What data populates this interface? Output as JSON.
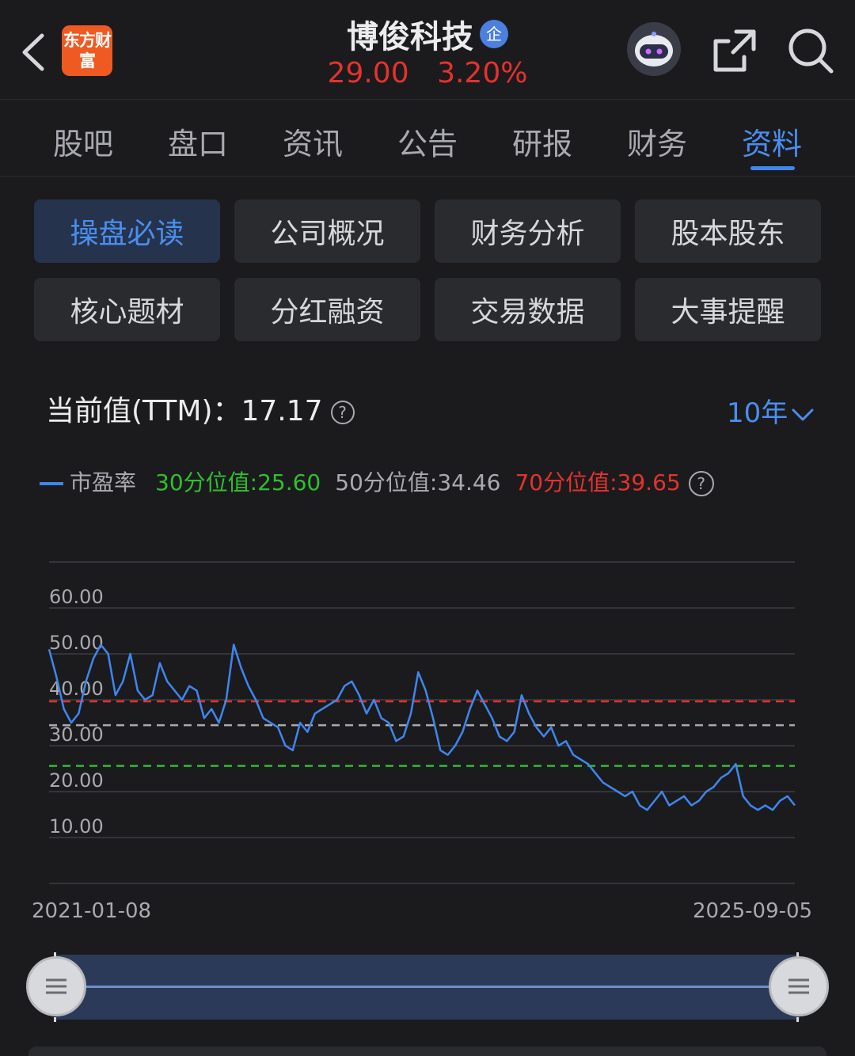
{
  "header": {
    "logo_text": "东方财富",
    "stock_name": "博俊科技",
    "badge": "企",
    "price": "29.00",
    "change_pct": "3.20%"
  },
  "tabs": [
    {
      "label": "股吧"
    },
    {
      "label": "盘口"
    },
    {
      "label": "资讯"
    },
    {
      "label": "公告"
    },
    {
      "label": "研报"
    },
    {
      "label": "财务"
    },
    {
      "label": "资料",
      "active": true
    }
  ],
  "sub_buttons": [
    {
      "label": "操盘必读",
      "active": true
    },
    {
      "label": "公司概况"
    },
    {
      "label": "财务分析"
    },
    {
      "label": "股本股东"
    },
    {
      "label": "核心题材"
    },
    {
      "label": "分红融资"
    },
    {
      "label": "交易数据"
    },
    {
      "label": "大事提醒"
    }
  ],
  "current_value": {
    "label": "当前值(TTM)：",
    "value": "17.17",
    "range": "10年"
  },
  "legend": {
    "series": "市盈率",
    "p30": "30分位值:25.60",
    "p50": "50分位值:34.46",
    "p70": "70分位值:39.65"
  },
  "colors": {
    "line": "#3f86ef",
    "p30": "#2fbf2f",
    "p50": "#a9aab0",
    "p70": "#e5322d",
    "price": "#e5322d",
    "accent": "#4a8ef0"
  },
  "chart_data": {
    "type": "line",
    "x_start": "2021-01-08",
    "x_end": "2025-09-05",
    "ylim": [
      0,
      70
    ],
    "yticks": [
      "60.00",
      "50.00",
      "40.00",
      "30.00",
      "20.00",
      "10.00"
    ],
    "ytick_values": [
      60,
      50,
      40,
      30,
      20,
      10
    ],
    "reference_lines": [
      {
        "name": "30分位值",
        "value": 25.6
      },
      {
        "name": "50分位值",
        "value": 34.46
      },
      {
        "name": "70分位值",
        "value": 39.65
      }
    ],
    "series": [
      {
        "name": "市盈率",
        "values": [
          51,
          45,
          38,
          35,
          37,
          44,
          49,
          52,
          50,
          41,
          44,
          50,
          42,
          40,
          41,
          48,
          44,
          42,
          40,
          43,
          42,
          36,
          38,
          35,
          40,
          52,
          47,
          43,
          40,
          36,
          35,
          34,
          30,
          29,
          35,
          33,
          37,
          38,
          39,
          40,
          43,
          44,
          41,
          37,
          40,
          36,
          35,
          31,
          32,
          37,
          46,
          42,
          36,
          29,
          28,
          30,
          33,
          38,
          42,
          39,
          36,
          32,
          31,
          33,
          41,
          37,
          34,
          32,
          34,
          30,
          31,
          28,
          27,
          26,
          24,
          22,
          21,
          20,
          19,
          20,
          17,
          16,
          18,
          20,
          17,
          18,
          19,
          17,
          18,
          20,
          21,
          23,
          24,
          26,
          19,
          17,
          16,
          17,
          16,
          18,
          19,
          17
        ]
      }
    ]
  },
  "x_axis": {
    "start": "2021-01-08",
    "end": "2025-09-05"
  }
}
